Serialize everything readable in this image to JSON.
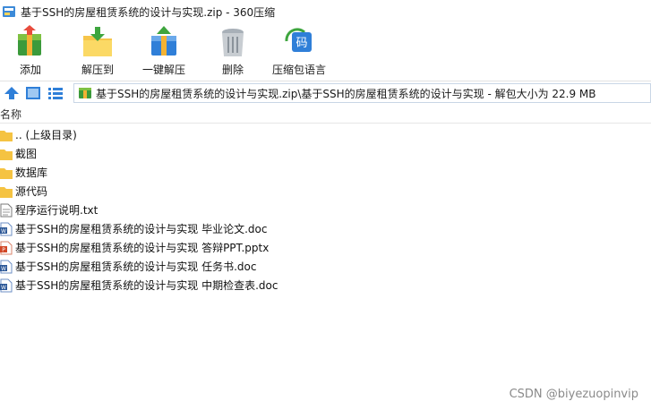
{
  "window": {
    "title": "基于SSH的房屋租赁系统的设计与实现.zip - 360压缩"
  },
  "toolbar": {
    "buttons": [
      {
        "label": "添加",
        "icon": "add-archive-icon"
      },
      {
        "label": "解压到",
        "icon": "extract-to-icon"
      },
      {
        "label": "一键解压",
        "icon": "one-click-extract-icon"
      },
      {
        "label": "删除",
        "icon": "delete-icon"
      },
      {
        "label": "压缩包语言",
        "icon": "archive-language-icon"
      }
    ]
  },
  "address": {
    "path": "基于SSH的房屋租赁系统的设计与实现.zip\\基于SSH的房屋租赁系统的设计与实现 - 解包大小为 22.9 MB"
  },
  "list_header": {
    "name": "名称"
  },
  "files": [
    {
      "name": ".. (上级目录)",
      "kind": "folder"
    },
    {
      "name": "截图",
      "kind": "folder"
    },
    {
      "name": "数据库",
      "kind": "folder"
    },
    {
      "name": "源代码",
      "kind": "folder"
    },
    {
      "name": "程序运行说明.txt",
      "kind": "txt"
    },
    {
      "name": "基于SSH的房屋租赁系统的设计与实现 毕业论文.doc",
      "kind": "doc"
    },
    {
      "name": "基于SSH的房屋租赁系统的设计与实现 答辩PPT.pptx",
      "kind": "ppt"
    },
    {
      "name": "基于SSH的房屋租赁系统的设计与实现 任务书.doc",
      "kind": "doc"
    },
    {
      "name": "基于SSH的房屋租赁系统的设计与实现 中期检查表.doc",
      "kind": "doc"
    }
  ],
  "watermark": "CSDN @biyezuopinvip",
  "colors": {
    "folder": "#f5c342",
    "accent_blue": "#2f7fd8",
    "ppt": "#d24726",
    "doc": "#2b5797"
  }
}
